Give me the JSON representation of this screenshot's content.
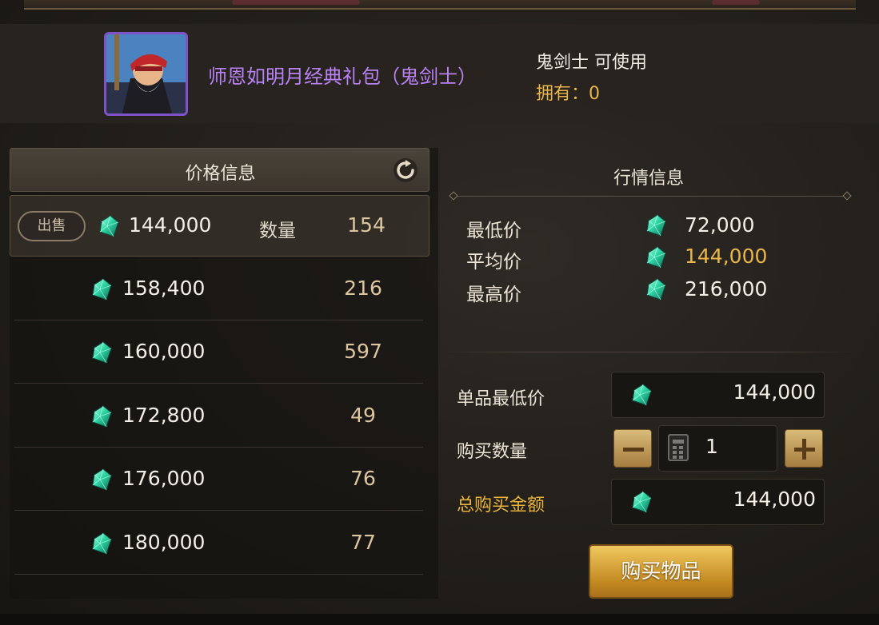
{
  "item": {
    "name": "师恩如明月经典礼包（鬼剑士）",
    "usable": "鬼剑士 可使用",
    "owned": "拥有：0"
  },
  "price_info": {
    "title": "价格信息",
    "sell_label": "出售",
    "qty_label": "数量",
    "rows": [
      {
        "price": "144,000",
        "qty": "154"
      },
      {
        "price": "158,400",
        "qty": "216"
      },
      {
        "price": "160,000",
        "qty": "597"
      },
      {
        "price": "172,800",
        "qty": "49"
      },
      {
        "price": "176,000",
        "qty": "76"
      },
      {
        "price": "180,000",
        "qty": "77"
      }
    ]
  },
  "market": {
    "title": "行情信息",
    "min_label": "最低价",
    "min_value": "72,000",
    "avg_label": "平均价",
    "avg_value": "144,000",
    "max_label": "最高价",
    "max_value": "216,000"
  },
  "purchase": {
    "unit_min_label": "单品最低价",
    "unit_min_value": "144,000",
    "qty_label": "购买数量",
    "qty_value": "1",
    "total_label": "总购买金额",
    "total_value": "144,000",
    "buy_label": "购买物品"
  },
  "colors": {
    "item_name": "#b982f5",
    "owned": "#e8b64a",
    "avg_price": "#e8b64a",
    "total_label": "#e8b43a",
    "gem": "#2fd6a4",
    "buy_button": "#d9a53a"
  },
  "icons": {
    "currency": "gem-icon",
    "refresh": "refresh-icon",
    "calculator": "calculator-icon",
    "minus": "minus-icon",
    "plus": "plus-icon"
  }
}
